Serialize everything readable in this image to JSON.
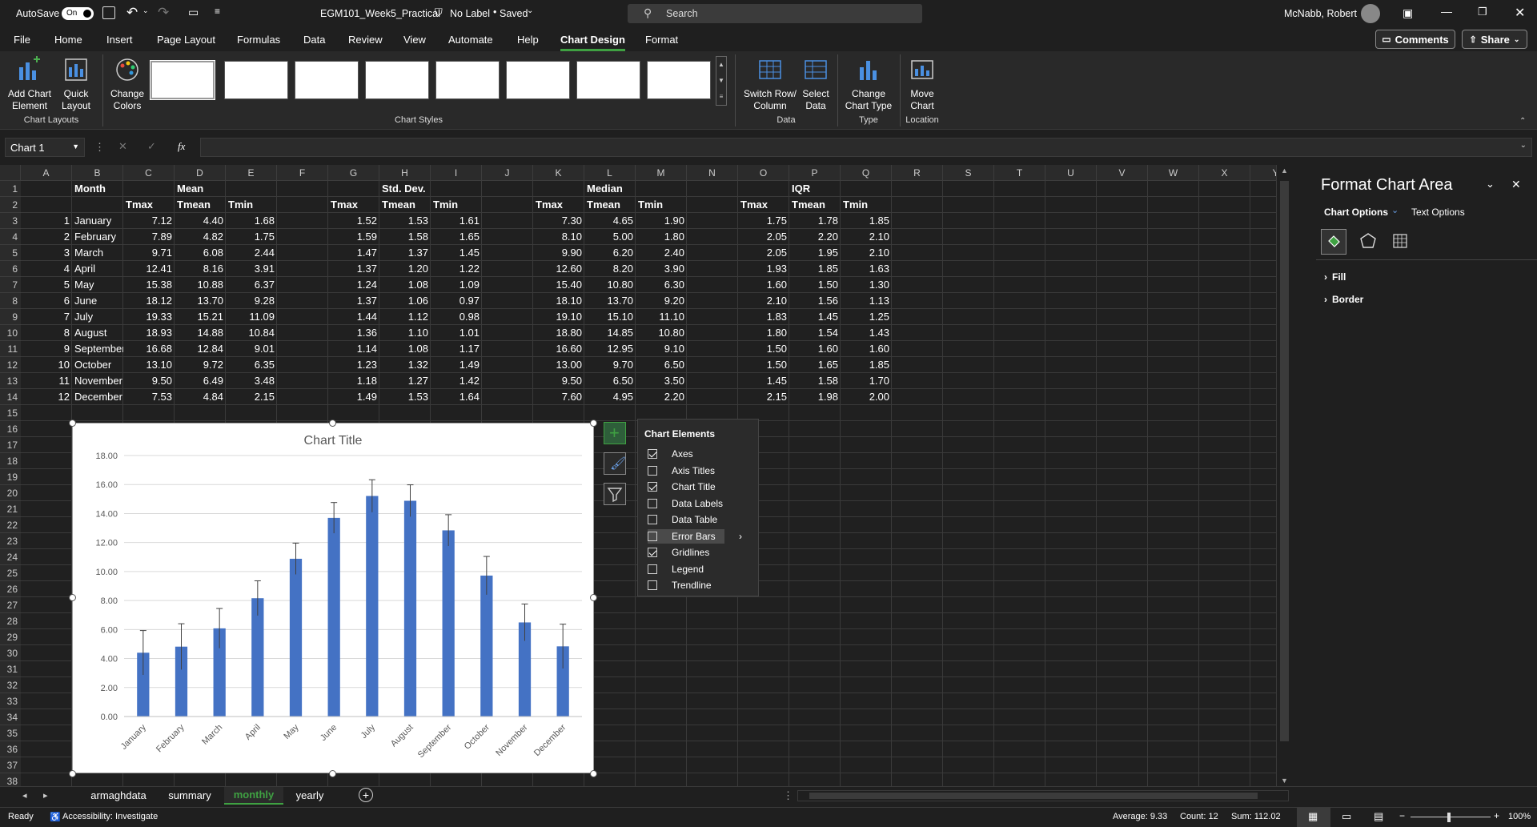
{
  "titlebar": {
    "autosave_label": "AutoSave",
    "autosave_state": "On",
    "filename": "EGM101_Week5_Practical",
    "label_status": "No Label",
    "save_status": "Saved",
    "search_placeholder": "Search",
    "user_name": "McNabb, Robert"
  },
  "ribbon": {
    "tabs": [
      "File",
      "Home",
      "Insert",
      "Page Layout",
      "Formulas",
      "Data",
      "Review",
      "View",
      "Automate",
      "Help",
      "Chart Design",
      "Format"
    ],
    "active_tab": "Chart Design",
    "comments_label": "Comments",
    "share_label": "Share",
    "buttons": {
      "add_chart_element": "Add Chart Element",
      "quick_layout": "Quick Layout",
      "change_colors": "Change Colors",
      "switch_row_column": "Switch Row/ Column",
      "select_data": "Select Data",
      "change_chart_type": "Change Chart Type",
      "move_chart": "Move Chart"
    },
    "groups": {
      "chart_layouts": "Chart Layouts",
      "chart_styles": "Chart Styles",
      "data": "Data",
      "type": "Type",
      "location": "Location"
    }
  },
  "formula_bar": {
    "name_box": "Chart 1",
    "fx": "fx",
    "content": ""
  },
  "sheet": {
    "columns": [
      "A",
      "B",
      "C",
      "D",
      "E",
      "F",
      "G",
      "H",
      "I",
      "J",
      "K",
      "L",
      "M",
      "N",
      "O",
      "P",
      "Q",
      "R",
      "S",
      "T",
      "U",
      "V",
      "W",
      "X",
      "Y"
    ],
    "rows": [
      "1",
      "2",
      "3",
      "4",
      "5",
      "6",
      "7",
      "8",
      "9",
      "10",
      "11",
      "12",
      "13",
      "14",
      "15",
      "16",
      "17",
      "18",
      "19",
      "20",
      "21",
      "22",
      "23",
      "24",
      "25",
      "26",
      "27",
      "28",
      "29",
      "30",
      "31",
      "32",
      "33",
      "34",
      "35",
      "36",
      "37",
      "38"
    ],
    "headers_row1": {
      "B": "Month",
      "D": "Mean",
      "H": "Std. Dev.",
      "L": "Median",
      "P": "IQR"
    },
    "headers_row2": {
      "C": "Tmax",
      "D": "Tmean",
      "E": "Tmin",
      "G": "Tmax",
      "H": "Tmean",
      "I": "Tmin",
      "K": "Tmax",
      "L": "Tmean",
      "M": "Tmin",
      "O": "Tmax",
      "P": "Tmean",
      "Q": "Tmin"
    },
    "data": [
      [
        "1",
        "January",
        "7.12",
        "4.40",
        "1.68",
        "1.52",
        "1.53",
        "1.61",
        "7.30",
        "4.65",
        "1.90",
        "1.75",
        "1.78",
        "1.85"
      ],
      [
        "2",
        "February",
        "7.89",
        "4.82",
        "1.75",
        "1.59",
        "1.58",
        "1.65",
        "8.10",
        "5.00",
        "1.80",
        "2.05",
        "2.20",
        "2.10"
      ],
      [
        "3",
        "March",
        "9.71",
        "6.08",
        "2.44",
        "1.47",
        "1.37",
        "1.45",
        "9.90",
        "6.20",
        "2.40",
        "2.05",
        "1.95",
        "2.10"
      ],
      [
        "4",
        "April",
        "12.41",
        "8.16",
        "3.91",
        "1.37",
        "1.20",
        "1.22",
        "12.60",
        "8.20",
        "3.90",
        "1.93",
        "1.85",
        "1.63"
      ],
      [
        "5",
        "May",
        "15.38",
        "10.88",
        "6.37",
        "1.24",
        "1.08",
        "1.09",
        "15.40",
        "10.80",
        "6.30",
        "1.60",
        "1.50",
        "1.30"
      ],
      [
        "6",
        "June",
        "18.12",
        "13.70",
        "9.28",
        "1.37",
        "1.06",
        "0.97",
        "18.10",
        "13.70",
        "9.20",
        "2.10",
        "1.56",
        "1.13"
      ],
      [
        "7",
        "July",
        "19.33",
        "15.21",
        "11.09",
        "1.44",
        "1.12",
        "0.98",
        "19.10",
        "15.10",
        "11.10",
        "1.83",
        "1.45",
        "1.25"
      ],
      [
        "8",
        "August",
        "18.93",
        "14.88",
        "10.84",
        "1.36",
        "1.10",
        "1.01",
        "18.80",
        "14.85",
        "10.80",
        "1.80",
        "1.54",
        "1.43"
      ],
      [
        "9",
        "September",
        "16.68",
        "12.84",
        "9.01",
        "1.14",
        "1.08",
        "1.17",
        "16.60",
        "12.95",
        "9.10",
        "1.50",
        "1.60",
        "1.60"
      ],
      [
        "10",
        "October",
        "13.10",
        "9.72",
        "6.35",
        "1.23",
        "1.32",
        "1.49",
        "13.00",
        "9.70",
        "6.50",
        "1.50",
        "1.65",
        "1.85"
      ],
      [
        "11",
        "November",
        "9.50",
        "6.49",
        "3.48",
        "1.18",
        "1.27",
        "1.42",
        "9.50",
        "6.50",
        "3.50",
        "1.45",
        "1.58",
        "1.70"
      ],
      [
        "12",
        "December",
        "7.53",
        "4.84",
        "2.15",
        "1.49",
        "1.53",
        "1.64",
        "7.60",
        "4.95",
        "2.20",
        "2.15",
        "1.98",
        "2.00"
      ]
    ]
  },
  "chart_data": {
    "type": "bar",
    "title": "Chart Title",
    "categories": [
      "January",
      "February",
      "March",
      "April",
      "May",
      "June",
      "July",
      "August",
      "September",
      "October",
      "November",
      "December"
    ],
    "values": [
      4.4,
      4.82,
      6.08,
      8.16,
      10.88,
      13.7,
      15.21,
      14.88,
      12.84,
      9.72,
      6.49,
      4.84
    ],
    "error_plus": [
      1.53,
      1.58,
      1.37,
      1.2,
      1.08,
      1.06,
      1.12,
      1.1,
      1.08,
      1.32,
      1.27,
      1.53
    ],
    "ylim": [
      0,
      18
    ],
    "yticks": [
      "0.00",
      "2.00",
      "4.00",
      "6.00",
      "8.00",
      "10.00",
      "12.00",
      "14.00",
      "16.00",
      "18.00"
    ],
    "bar_color": "#4472c4",
    "grid": true,
    "xlabel": "",
    "ylabel": ""
  },
  "chart_elements_menu": {
    "title": "Chart Elements",
    "items": [
      {
        "label": "Axes",
        "checked": true
      },
      {
        "label": "Axis Titles",
        "checked": false
      },
      {
        "label": "Chart Title",
        "checked": true
      },
      {
        "label": "Data Labels",
        "checked": false
      },
      {
        "label": "Data Table",
        "checked": false
      },
      {
        "label": "Error Bars",
        "checked": false
      },
      {
        "label": "Gridlines",
        "checked": true
      },
      {
        "label": "Legend",
        "checked": false
      },
      {
        "label": "Trendline",
        "checked": false
      }
    ]
  },
  "format_pane": {
    "title": "Format Chart Area",
    "tab_chart_options": "Chart Options",
    "tab_text_options": "Text Options",
    "sections": [
      "Fill",
      "Border"
    ]
  },
  "sheet_tabs": {
    "tabs": [
      "armaghdata",
      "summary",
      "monthly",
      "yearly"
    ],
    "active": "monthly"
  },
  "status": {
    "ready": "Ready",
    "accessibility": "Accessibility: Investigate",
    "average": "Average: 9.33",
    "count": "Count: 12",
    "sum": "Sum: 112.02",
    "zoom": "100%"
  },
  "colors": {
    "accent": "#3fa142",
    "bar": "#4472c4"
  }
}
